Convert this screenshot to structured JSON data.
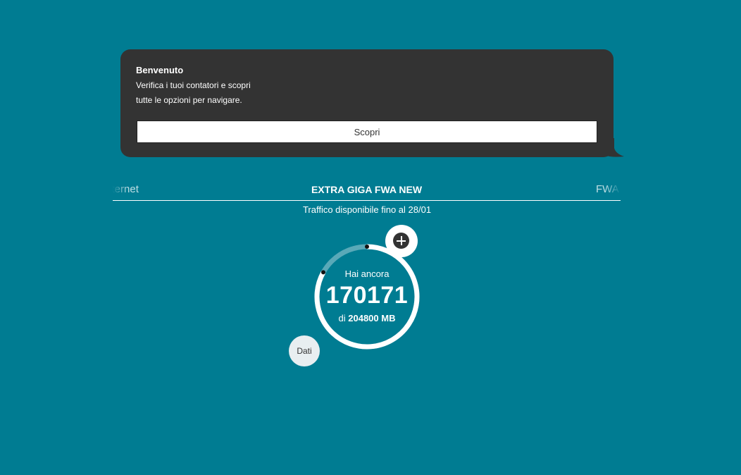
{
  "welcome": {
    "title": "Benvenuto",
    "line1": "Verifica i tuoi contatori e scopri",
    "line2": "tutte le opzioni per navigare.",
    "button_label": "Scopri"
  },
  "tabs": {
    "left": "Internet",
    "current": "EXTRA GIGA FWA NEW",
    "right": "FWA Outdoor"
  },
  "subtitle": "Traffico disponibile fino al 28/01",
  "gauge": {
    "caption": "Hai ancora",
    "value": "170171",
    "total_prefix": "di",
    "total": "204800 MB",
    "remaining_fraction": 0.831
  },
  "dati_label": "Dati",
  "icons": {
    "plus": "plus-circle-icon"
  },
  "colors": {
    "background": "#007c92",
    "bubble": "#333333",
    "accent": "#ffffff"
  }
}
